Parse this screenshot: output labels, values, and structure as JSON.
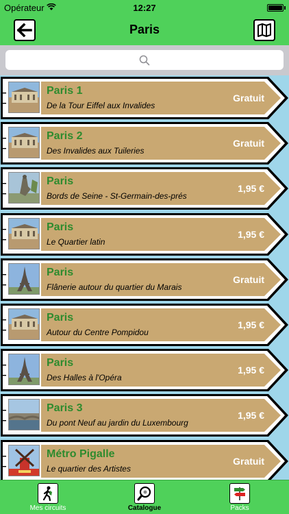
{
  "status_bar": {
    "carrier": "Opérateur",
    "time": "12:27"
  },
  "nav": {
    "title": "Paris",
    "back_icon": "back-arrow-icon",
    "map_icon": "map-icon"
  },
  "search": {
    "placeholder": ""
  },
  "colors": {
    "green": "#4fd15a",
    "card": "#c9a872",
    "title_green": "#2e8b2e",
    "water": "#9fd6ea"
  },
  "circuits": [
    {
      "title": "Paris 1",
      "subtitle": "De la Tour Eiffel aux Invalides",
      "price": "Gratuit",
      "thumb": "palace"
    },
    {
      "title": "Paris 2",
      "subtitle": "Des Invalides aux Tuileries",
      "price": "Gratuit",
      "thumb": "palace"
    },
    {
      "title": "Paris",
      "subtitle": "Bords de Seine - St-Germain-des-prés",
      "price": "1,95 €",
      "thumb": "statue"
    },
    {
      "title": "Paris",
      "subtitle": "Le Quartier latin",
      "price": "1,95 €",
      "thumb": "palace"
    },
    {
      "title": "Paris",
      "subtitle": "Flânerie autour du quartier du Marais",
      "price": "Gratuit",
      "thumb": "tower"
    },
    {
      "title": "Paris",
      "subtitle": "Autour du Centre Pompidou",
      "price": "1,95 €",
      "thumb": "palace"
    },
    {
      "title": "Paris",
      "subtitle": "Des Halles à l'Opéra",
      "price": "1,95 €",
      "thumb": "tower"
    },
    {
      "title": "Paris 3",
      "subtitle": "Du pont Neuf au jardin du Luxembourg",
      "price": "1,95 €",
      "thumb": "river"
    },
    {
      "title": "Métro Pigalle",
      "subtitle": "Le quartier des Artistes",
      "price": "Gratuit",
      "thumb": "mill"
    }
  ],
  "tabs": [
    {
      "label": "Mes circuits",
      "icon": "walker-icon",
      "active": false
    },
    {
      "label": "Catalogue",
      "icon": "magnifier-icon",
      "active": true
    },
    {
      "label": "Packs",
      "icon": "signpost-icon",
      "active": false
    }
  ]
}
